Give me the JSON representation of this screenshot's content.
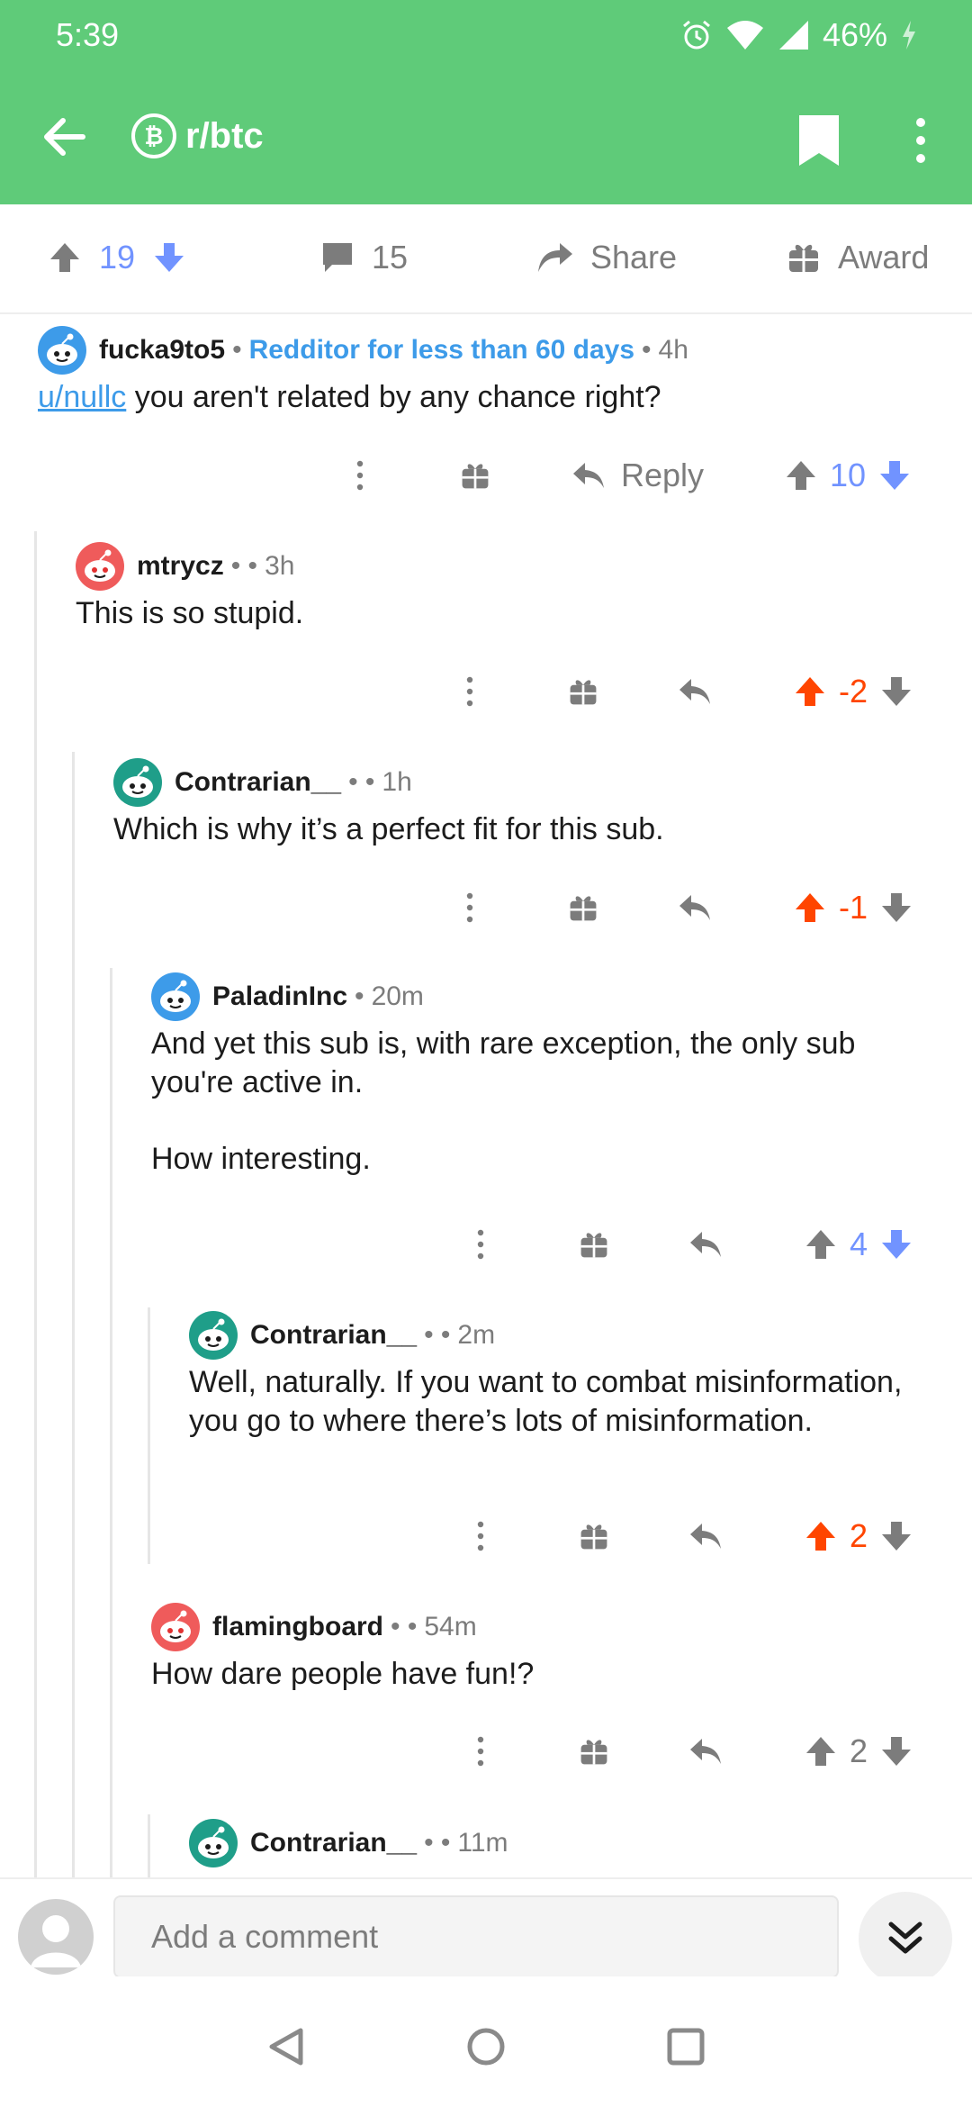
{
  "status_bar": {
    "time": "5:39",
    "battery": "46%"
  },
  "header": {
    "subreddit": "r/btc",
    "sub_icon": "bitcoin-icon"
  },
  "post_bar": {
    "score": "19",
    "comments": "15",
    "share_label": "Share",
    "award_label": "Award"
  },
  "comments": [
    {
      "author": "fucka9to5",
      "flair": "Redditor for less than 60 days",
      "time": "4h",
      "mention": "u/nullc",
      "body": " you aren't related by any chance right?",
      "reply_label": "Reply",
      "score": "10"
    },
    {
      "author": "mtrycz",
      "time": "3h",
      "body": "This is so stupid.",
      "score": "-2"
    },
    {
      "author": "Contrarian__",
      "time": "1h",
      "body": "Which is why it’s a perfect fit for this sub.",
      "score": "-1"
    },
    {
      "author": "PaladinInc",
      "time": "20m",
      "body": "And yet this sub is, with rare exception, the only sub you're active in.",
      "body2": "How interesting.",
      "score": "4"
    },
    {
      "author": "Contrarian__",
      "time": "2m",
      "body": "Well, naturally. If you want to combat misinformation, you go to where there’s lots of misinformation.",
      "score": "2"
    },
    {
      "author": "flamingboard",
      "time": "54m",
      "body": "How dare people have fun!?",
      "score": "2"
    },
    {
      "author": "Contrarian__",
      "time": "11m"
    }
  ],
  "composer": {
    "placeholder": "Add a comment"
  },
  "colors": {
    "header": "#5fcb79",
    "upvote_blue": "#7193ff",
    "orange": "#ff4500",
    "link": "#3d9be9"
  }
}
